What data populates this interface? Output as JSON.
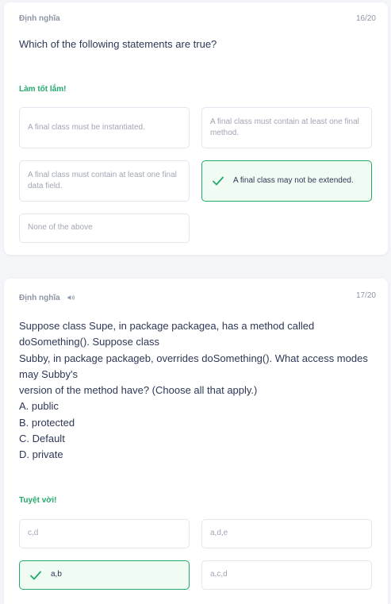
{
  "cards": [
    {
      "term_label": "Định nghĩa",
      "counter": "16/20",
      "question": "Which of the following statements are true?",
      "feedback": "Làm tốt lắm!",
      "options": [
        {
          "text": "A final class must be instantiated.",
          "correct": false
        },
        {
          "text": "A final class must contain at least one final method.",
          "correct": false
        },
        {
          "text": "A final class must contain at least one final data field.",
          "correct": false
        },
        {
          "text": "A final class may not be extended.",
          "correct": true
        },
        {
          "text": "None of the above",
          "correct": false
        }
      ]
    },
    {
      "term_label": "Định nghĩa",
      "counter": "17/20",
      "audio_icon": "speaker-icon",
      "question_lines": [
        "Suppose class Supe, in package packagea, has a method called",
        "doSomething(). Suppose class",
        "Subby, in package packageb, overrides doSomething(). What access modes",
        "may Subby's",
        "version of the method have? (Choose all that apply.)",
        "A. public",
        "B. protected",
        "C. Default",
        "D. private"
      ],
      "feedback": "Tuyệt vời!",
      "options": [
        {
          "text": "c,d",
          "correct": false
        },
        {
          "text": "a,d,e",
          "correct": false
        },
        {
          "text": "a,b",
          "correct": true
        },
        {
          "text": "a,c,d",
          "correct": false
        }
      ]
    }
  ],
  "colors": {
    "correct_green": "#23a96a",
    "correct_bg": "#f0fbf4",
    "option_border": "#e3e6ee",
    "muted_text": "#8d94a5",
    "page_bg": "#f4f5f9"
  }
}
